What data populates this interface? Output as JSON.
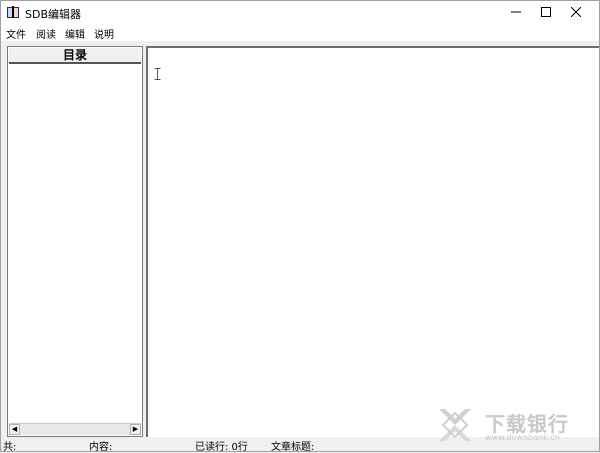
{
  "window": {
    "title": "SDB编辑器",
    "icon": "book-app-icon",
    "controls": {
      "minimize": "minimize-icon",
      "maximize": "maximize-icon",
      "close": "close-icon"
    }
  },
  "menu": {
    "items": [
      {
        "label": "文件"
      },
      {
        "label": "阅读"
      },
      {
        "label": "编辑"
      },
      {
        "label": "说明"
      }
    ]
  },
  "toc": {
    "header": "目录",
    "scroll_left": "◀",
    "scroll_right": "▶"
  },
  "statusbar": {
    "total": "共:",
    "content": "内容:",
    "read": "已读行: 0行",
    "article_title": "文章标题:"
  },
  "watermark": {
    "main": "下载银行",
    "sub": "www.downbank.cn"
  },
  "colors": {
    "window_bg": "#f0f0f0",
    "titlebar_bg": "#ffffff",
    "panel_border": "#6d6d6d",
    "watermark": "#c9c9c9"
  }
}
